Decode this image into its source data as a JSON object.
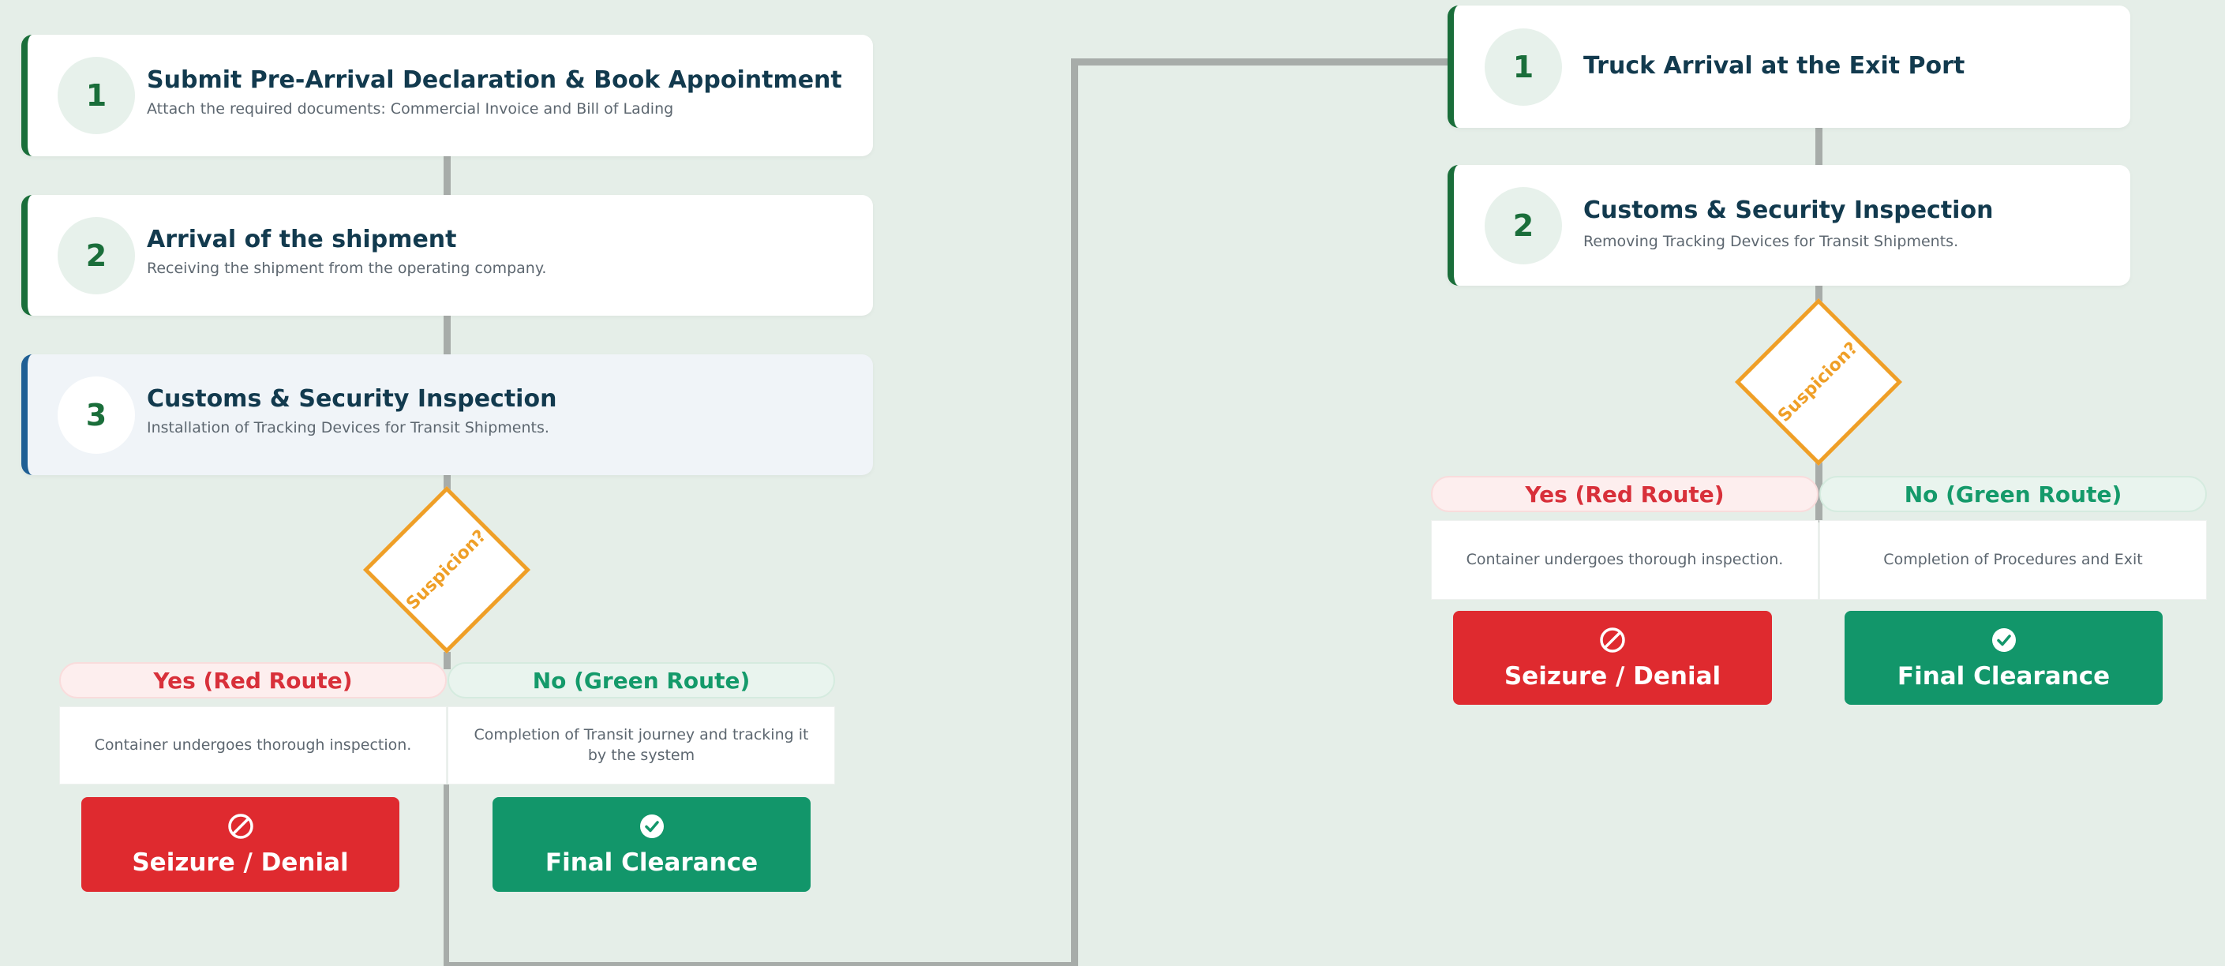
{
  "left_flow": {
    "steps": [
      {
        "number": "1",
        "title": "Submit Pre-Arrival Declaration & Book Appointment",
        "description": "Attach the required documents: Commercial Invoice and Bill of Lading"
      },
      {
        "number": "2",
        "title": "Arrival of the shipment",
        "description": "Receiving the shipment from the operating company."
      },
      {
        "number": "3",
        "title": "Customs & Security Inspection",
        "description": "Installation of Tracking Devices for Transit Shipments."
      }
    ],
    "decision": "Suspicion?",
    "yes_label": "Yes (Red Route)",
    "no_label": "No (Green Route)",
    "yes_description": "Container undergoes thorough inspection.",
    "no_description": "Completion of Transit journey and tracking it by the system",
    "denial_label": "Seizure / Denial",
    "clearance_label": "Final Clearance"
  },
  "right_flow": {
    "steps": [
      {
        "number": "1",
        "title": "Truck Arrival at the Exit Port"
      },
      {
        "number": "2",
        "title": "Customs & Security Inspection",
        "description": "Removing Tracking Devices for Transit Shipments."
      }
    ],
    "decision": "Suspicion?",
    "yes_label": "Yes (Red Route)",
    "no_label": "No (Green Route)",
    "yes_description": "Container undergoes thorough inspection.",
    "no_description": "Completion of Procedures and Exit",
    "denial_label": "Seizure / Denial",
    "clearance_label": "Final Clearance"
  },
  "icons": {
    "denial": "ban-icon",
    "clearance": "check-circle-icon"
  },
  "colors": {
    "background": "#e5eee8",
    "step_accent": "#1a6e3a",
    "step_accent_alt": "#1f5f94",
    "decision": "#ef9f27",
    "red_route": "#df2a2f",
    "green_route": "#12966a",
    "connector": "#a7aca9"
  }
}
